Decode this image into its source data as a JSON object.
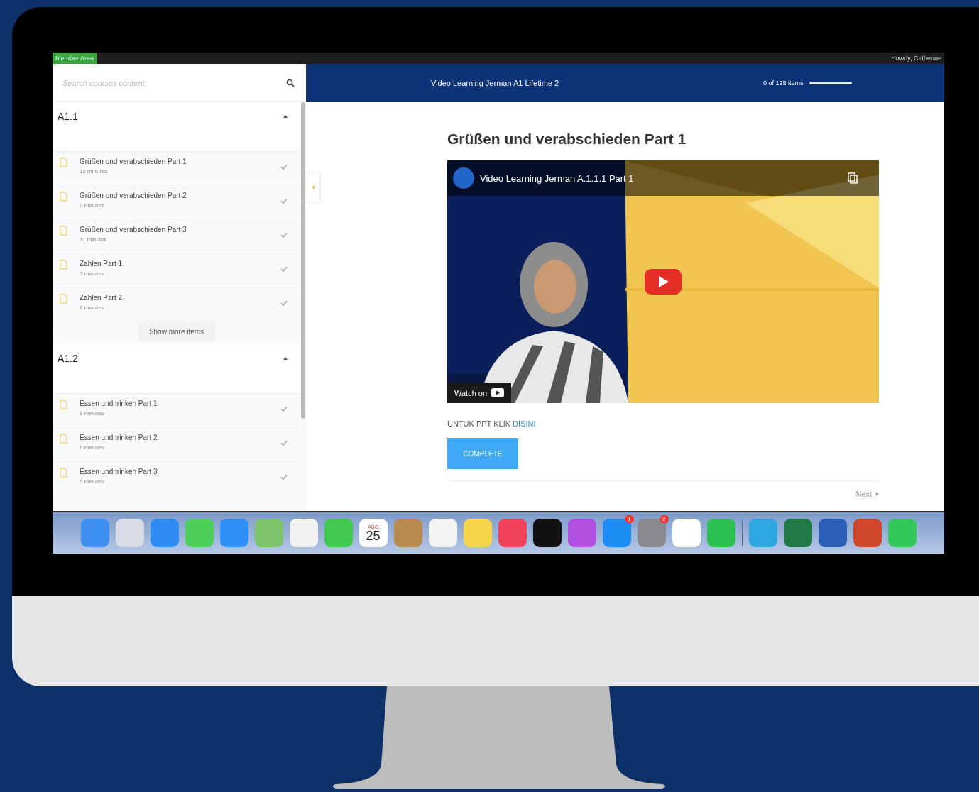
{
  "admin_bar": {
    "label": "Member Area",
    "greeting": "Howdy, Catherine"
  },
  "sidebar": {
    "search_placeholder": "Search courses content",
    "show_more": "Show more items",
    "sections": [
      {
        "title": "A1.1",
        "expanded": true,
        "lessons": [
          {
            "title": "Grüßen und verabschieden Part 1",
            "duration": "12 minutes",
            "completed": false
          },
          {
            "title": "Grüßen und verabschieden Part 2",
            "duration": "9 minutes",
            "completed": false
          },
          {
            "title": "Grüßen und verabschieden Part 3",
            "duration": "11 minutes",
            "completed": false
          },
          {
            "title": "Zahlen Part 1",
            "duration": "5 minutes",
            "completed": false
          },
          {
            "title": "Zahlen Part 2",
            "duration": "8 minutes",
            "completed": false
          }
        ]
      },
      {
        "title": "A1.2",
        "expanded": true,
        "lessons": [
          {
            "title": "Essen und trinken Part 1",
            "duration": "8 minutes",
            "completed": false
          },
          {
            "title": "Essen und trinken Part 2",
            "duration": "8 minutes",
            "completed": false
          },
          {
            "title": "Essen und trinken Part 3",
            "duration": "6 minutes",
            "completed": false
          }
        ]
      }
    ]
  },
  "header": {
    "course_title": "Video Learning Jerman A1 Lifetime 2",
    "progress_text": "0 of 125 items",
    "level": 0
  },
  "lesson": {
    "title": "Grüßen und verabschieden Part 1",
    "video": {
      "kind": "picture",
      "title": "Video Learning Jerman A.1.1.1 Part 1",
      "watch_on": "Watch on"
    },
    "note": "UNTUK PPT KLIK",
    "note_link": "DISINI",
    "complete_button": "COMPLETE",
    "next": "Next"
  },
  "dock": [
    {
      "color": "#3d8ff0"
    },
    {
      "color": "#d8dce6"
    },
    {
      "color": "#2f8cf2"
    },
    {
      "color": "#4cd05a"
    },
    {
      "color": "#2e8ff5"
    },
    {
      "color": "#7cc36a"
    },
    {
      "color": "#f2f2f2"
    },
    {
      "color": "#3fc94f"
    },
    {
      "color": "#ffffff",
      "month": "AUG",
      "day": "25"
    },
    {
      "color": "#b98a4e"
    },
    {
      "color": "#f4f4f4"
    },
    {
      "color": "#f7d54a"
    },
    {
      "color": "#f0435a"
    },
    {
      "color": "#111111"
    },
    {
      "color": "#b04fe0"
    },
    {
      "color": "#1e8cf5",
      "badge": "1"
    },
    {
      "color": "#8a8a8e",
      "badge": "2"
    },
    {
      "color": "#ffffff"
    },
    {
      "color": "#2dc152"
    },
    {
      "color": "#2ea6e0",
      "separator": true
    },
    {
      "color": "#1f7a45"
    },
    {
      "color": "#2b5fb5"
    },
    {
      "color": "#d0462a"
    },
    {
      "color": "#34c759"
    }
  ]
}
